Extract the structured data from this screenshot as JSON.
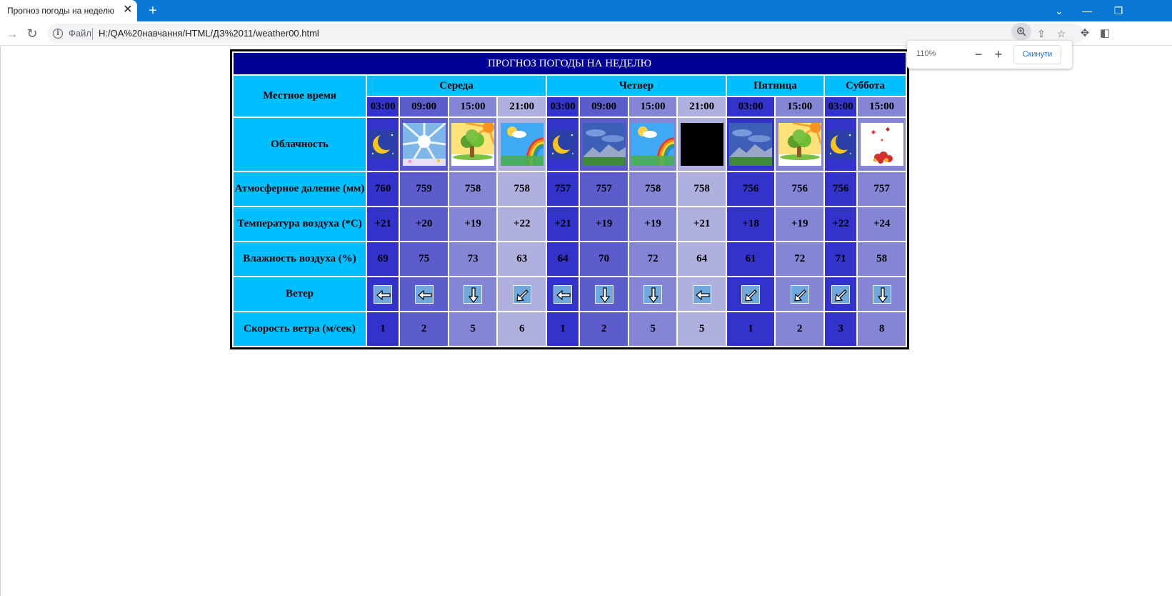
{
  "browser": {
    "tab_title": "Прогноз погоды на неделю",
    "tab_close": "✕",
    "new_tab": "+",
    "file_label": "Файл",
    "url": "H:/QA%20навчання/HTML/ДЗ%2011/weather00.html",
    "zoom_level": "110%",
    "zoom_minus": "−",
    "zoom_plus": "+",
    "zoom_reset": "Скинути"
  },
  "table": {
    "caption": "ПРОГНОЗ ПОГОДЫ НА НЕДЕЛЮ",
    "row_labels": {
      "time": "Местное время",
      "cloud": "Облачность",
      "pressure": "Атмосферное даление (мм)",
      "temperature": "Температура воздуха (*C)",
      "humidity": "Влажность воздуха (%)",
      "wind": "Ветер",
      "wind_speed": "Скорость ветра (м/сек)"
    },
    "days": [
      "Середа",
      "Четвер",
      "Пятница",
      "Суббота"
    ],
    "times": [
      "03:00",
      "09:00",
      "15:00",
      "21:00",
      "03:00",
      "09:00",
      "15:00",
      "21:00",
      "03:00",
      "15:00",
      "03:00",
      "15:00"
    ],
    "cloud_icons": [
      "moon-icon",
      "sunburst-icon",
      "sunny-tree-icon",
      "rainbow-icon",
      "moon-icon",
      "mountain-sky-icon",
      "rainbow-icon",
      "dark-night-icon",
      "mountain-sky-icon",
      "sunny-tree-icon",
      "moon-icon",
      "falling-leaves-icon"
    ],
    "pressure": [
      "760",
      "759",
      "758",
      "758",
      "757",
      "757",
      "758",
      "758",
      "756",
      "756",
      "756",
      "757"
    ],
    "temperature": [
      "+21",
      "+20",
      "+19",
      "+22",
      "+21",
      "+19",
      "+19",
      "+21",
      "+18",
      "+19",
      "+22",
      "+24"
    ],
    "humidity": [
      "69",
      "75",
      "73",
      "63",
      "64",
      "70",
      "72",
      "64",
      "61",
      "72",
      "71",
      "58"
    ],
    "wind_icons": [
      "arrow-left-icon",
      "arrow-left-icon",
      "arrow-down-icon",
      "arrow-down-left-icon",
      "arrow-left-icon",
      "arrow-down-icon",
      "arrow-down-icon",
      "arrow-left-icon",
      "arrow-down-left-icon",
      "arrow-down-left-icon",
      "arrow-down-left-icon",
      "arrow-down-icon"
    ],
    "wind_speed": [
      "1",
      "2",
      "5",
      "6",
      "1",
      "2",
      "5",
      "5",
      "1",
      "2",
      "3",
      "8"
    ]
  },
  "colors": {
    "caption_bg": "#000099",
    "header_bg": "#00bfff",
    "col_shades": [
      "#3333cc",
      "#5c5ccc",
      "#8585d6",
      "#b0b0de"
    ]
  }
}
